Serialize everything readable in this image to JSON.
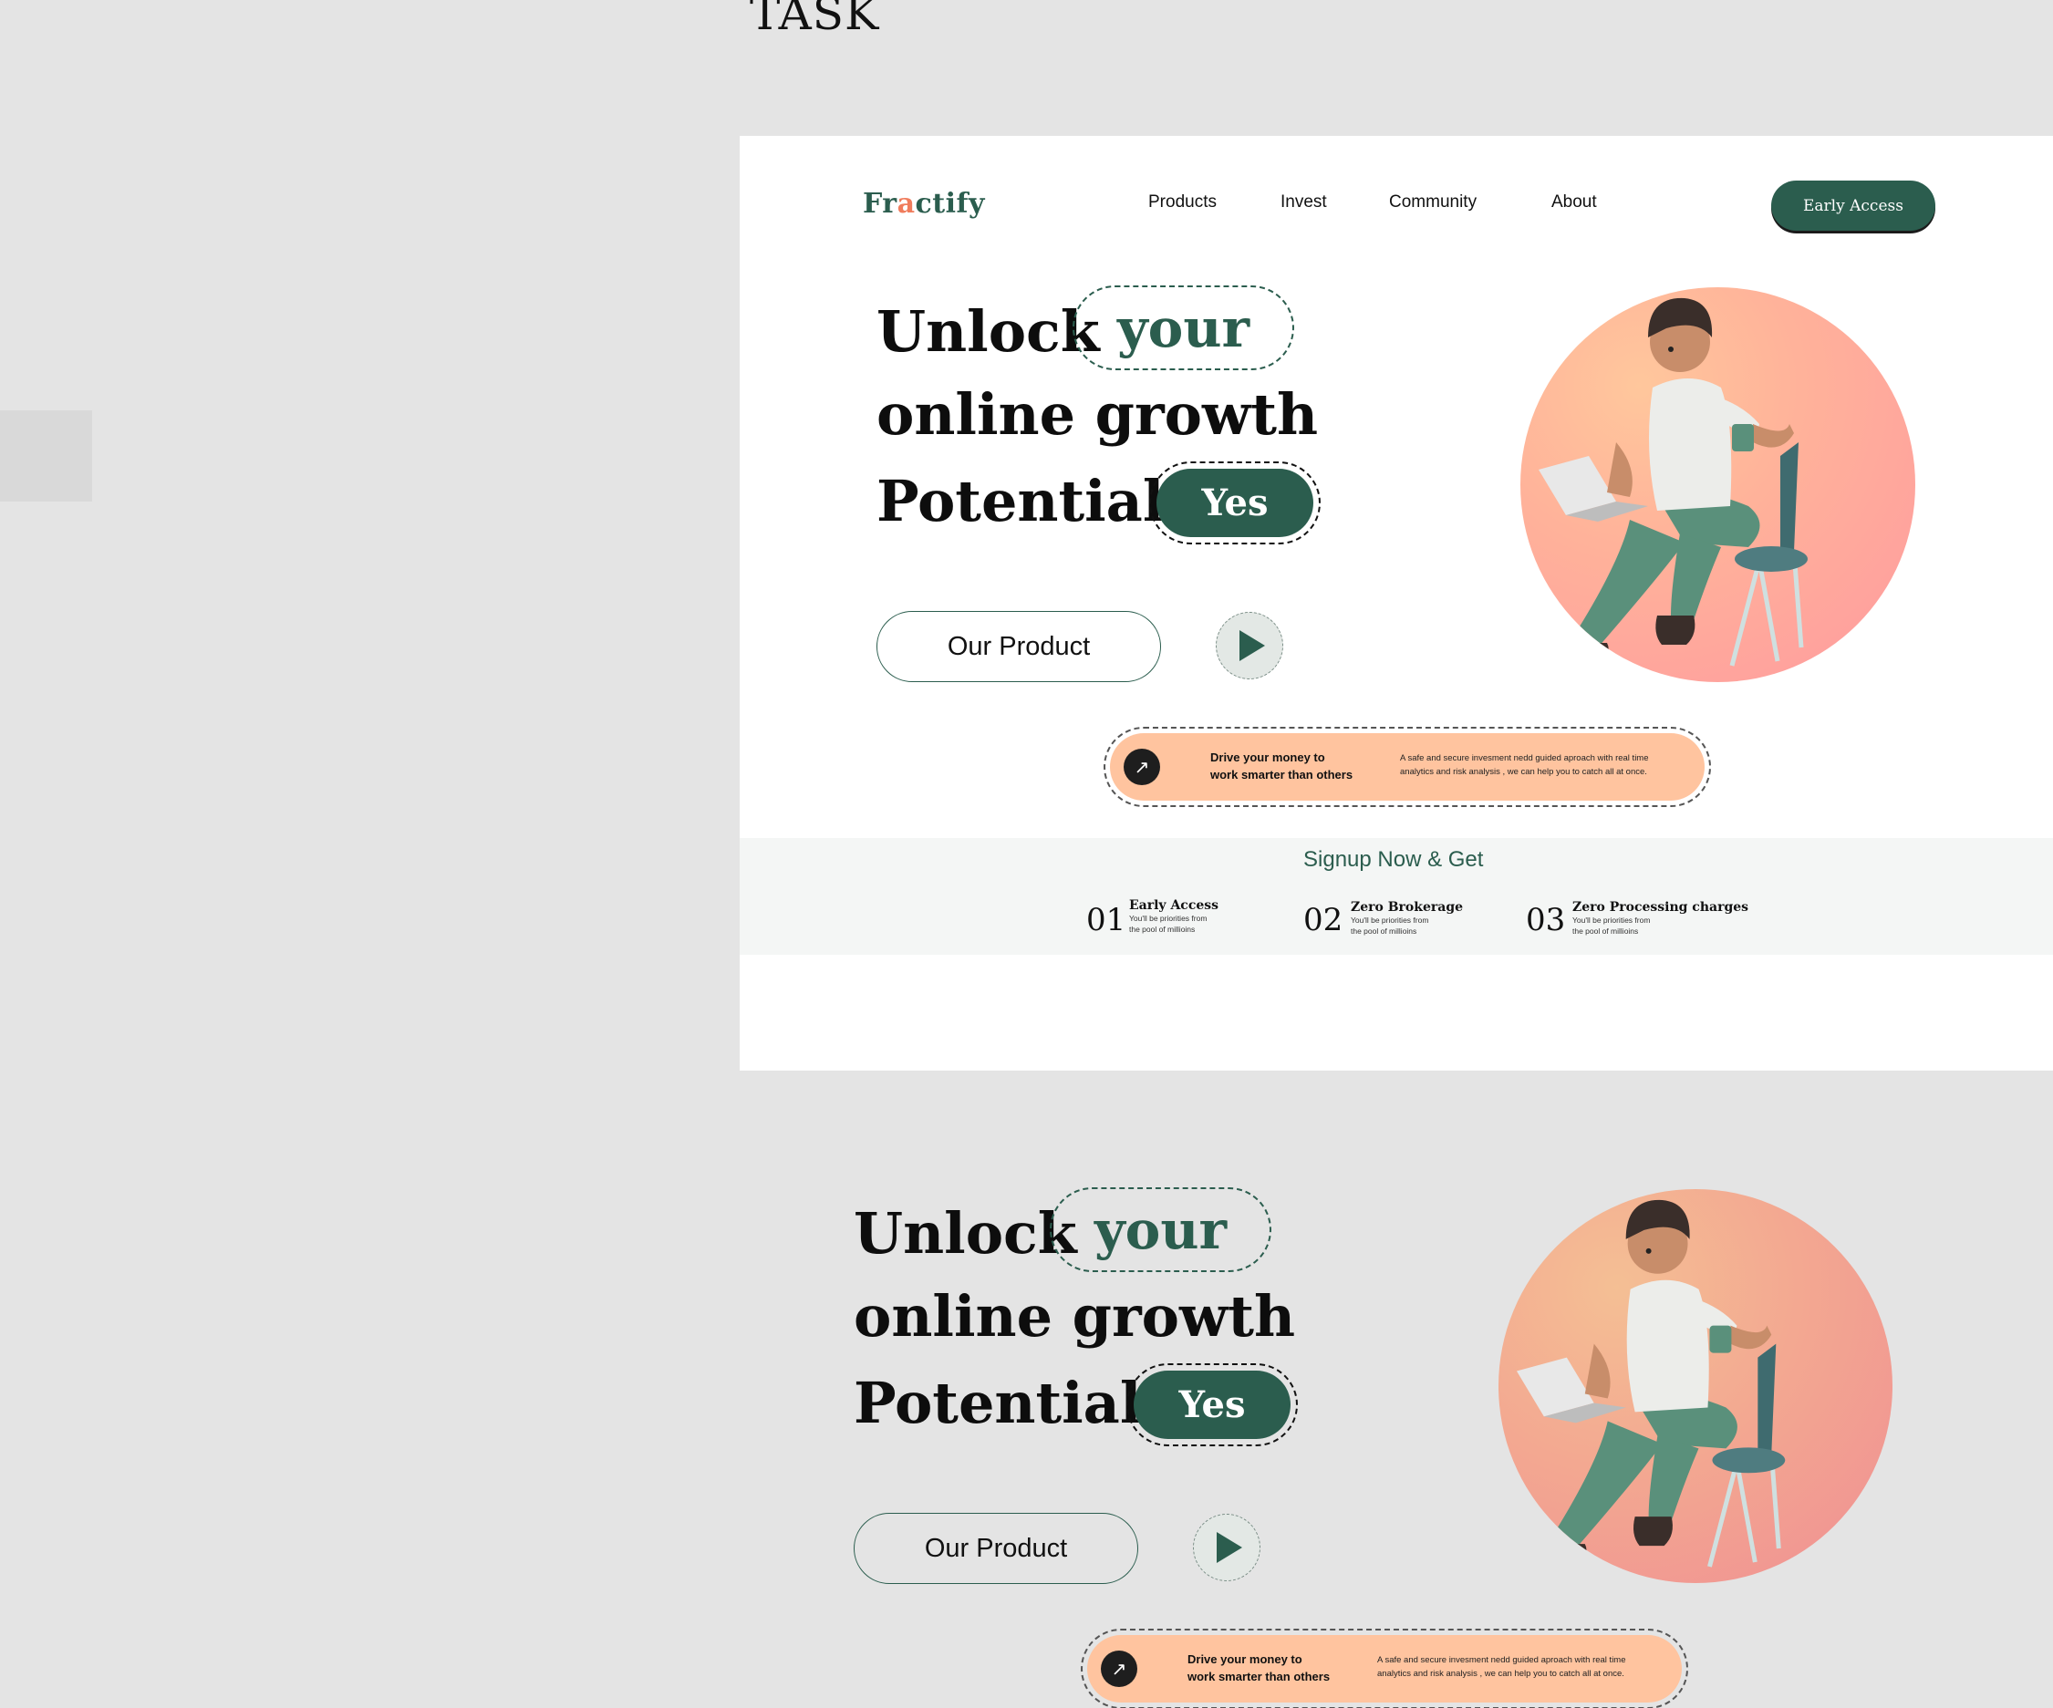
{
  "task_title": "TASK",
  "nav": {
    "logo_prefix": "Fr",
    "logo_mid": "a",
    "logo_suffix": "ctify",
    "links": [
      "Products",
      "Invest",
      "Community",
      "About"
    ],
    "cta": "Early Access"
  },
  "hero": {
    "line1": "Unlock",
    "highlight": "your",
    "line2": "online growth",
    "line3": "Potential",
    "yes": "Yes",
    "product_button": "Our Product"
  },
  "banner": {
    "icon": "arrow-up-right-icon",
    "heading_line1": "Drive your money to",
    "heading_line2": "work smarter than others",
    "desc_line1": "A safe and secure invesment nedd guided aproach with real time",
    "desc_line2": "analytics and risk analysis , we can help you to catch all at once."
  },
  "signup": {
    "title": "Signup Now & Get",
    "steps": [
      {
        "num": "01",
        "title": "Early Access",
        "desc1": "You'll be priorities from",
        "desc2": "the  pool of millioins"
      },
      {
        "num": "02",
        "title": "Zero Brokerage",
        "desc1": "You'll be priorities from",
        "desc2": "the  pool of millioins"
      },
      {
        "num": "03",
        "title": "Zero Processing charges",
        "desc1": "You'll be priorities from",
        "desc2": "the  pool of millioins"
      }
    ]
  },
  "colors": {
    "primary": "#2b5d4e",
    "banner": "#ffc49f",
    "accent": "#f07c5c",
    "background": "#e4e4e4"
  }
}
